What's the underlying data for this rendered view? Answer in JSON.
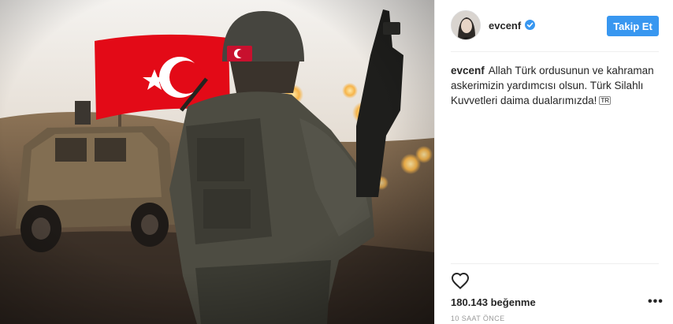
{
  "post": {
    "image_alt": "Soldier holding rifle before Turkish flag and armored vehicle"
  },
  "header": {
    "username": "evcenf",
    "verified_icon": "verified-badge-icon",
    "follow_label": "Takip Et"
  },
  "caption": {
    "username": "evcenf",
    "text": "Allah Türk ordusunun ve kahraman askerimizin yardımcısı olsun. Türk Silahlı Kuvvetleri daima dualarımızda!",
    "flag_emoji": "TR"
  },
  "actions": {
    "like_icon": "heart-icon",
    "likes_text": "180.143 beğenme",
    "more_label": "•••",
    "time_text": "10 SAAT ÖNCE"
  },
  "colors": {
    "accent": "#3897f0",
    "flag_red": "#e30a17",
    "text": "#262626",
    "muted": "#999999"
  }
}
